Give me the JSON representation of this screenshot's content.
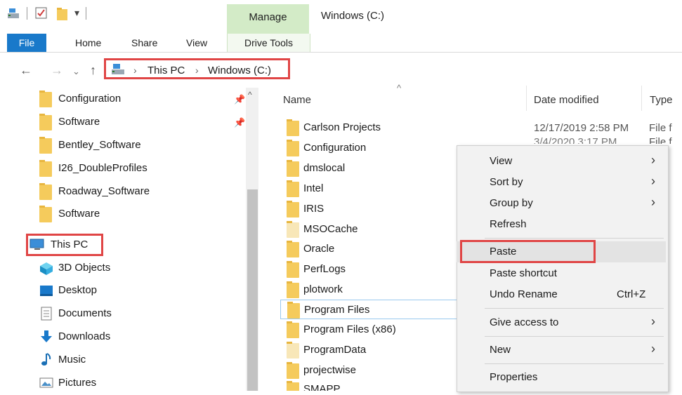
{
  "window": {
    "title": "Windows (C:)",
    "manage_label": "Manage"
  },
  "ribbon": {
    "tabs": [
      {
        "label": "File"
      },
      {
        "label": "Home"
      },
      {
        "label": "Share"
      },
      {
        "label": "View"
      },
      {
        "label": "Drive Tools"
      }
    ]
  },
  "address": {
    "crumbs": [
      "This PC",
      "Windows (C:)"
    ],
    "separator": "›"
  },
  "navpane": {
    "quick_access": [
      {
        "label": "Configuration",
        "icon": "folder-icon",
        "pinned": true
      },
      {
        "label": "Software",
        "icon": "folder-icon",
        "pinned": true
      },
      {
        "label": "Bentley_Software",
        "icon": "folder-icon"
      },
      {
        "label": "I26_DoubleProfiles",
        "icon": "folder-icon"
      },
      {
        "label": "Roadway_Software",
        "icon": "folder-icon"
      },
      {
        "label": "Software",
        "icon": "folder-icon"
      }
    ],
    "this_pc": {
      "label": "This PC",
      "icon": "computer-icon"
    },
    "this_pc_children": [
      {
        "label": "3D Objects",
        "icon": "3d-objects-icon"
      },
      {
        "label": "Desktop",
        "icon": "desktop-icon"
      },
      {
        "label": "Documents",
        "icon": "documents-icon"
      },
      {
        "label": "Downloads",
        "icon": "downloads-icon"
      },
      {
        "label": "Music",
        "icon": "music-icon"
      },
      {
        "label": "Pictures",
        "icon": "pictures-icon"
      }
    ]
  },
  "filelist": {
    "columns": {
      "name": "Name",
      "date": "Date modified",
      "type": "Type"
    },
    "rows": [
      {
        "name": "Carlson Projects",
        "date": "12/17/2019 2:58 PM",
        "type": "File f"
      },
      {
        "name": "Configuration",
        "date": "3/4/2020 3:17 PM",
        "type": "File f"
      },
      {
        "name": "dmslocal"
      },
      {
        "name": "Intel"
      },
      {
        "name": "IRIS"
      },
      {
        "name": "MSOCache"
      },
      {
        "name": "Oracle"
      },
      {
        "name": "PerfLogs"
      },
      {
        "name": "plotwork"
      },
      {
        "name": "Program Files"
      },
      {
        "name": "Program Files (x86)"
      },
      {
        "name": "ProgramData"
      },
      {
        "name": "projectwise"
      },
      {
        "name": "SMAPP"
      }
    ]
  },
  "context_menu": {
    "items": [
      {
        "label": "View",
        "submenu": true
      },
      {
        "label": "Sort by",
        "submenu": true
      },
      {
        "label": "Group by",
        "submenu": true
      },
      {
        "label": "Refresh"
      },
      {
        "label": "Paste"
      },
      {
        "label": "Paste shortcut"
      },
      {
        "label": "Undo Rename",
        "shortcut": "Ctrl+Z"
      },
      {
        "label": "Give access to",
        "submenu": true
      },
      {
        "label": "New",
        "submenu": true
      },
      {
        "label": "Properties"
      }
    ],
    "chevron": "›"
  },
  "colors": {
    "highlight": "#e04545",
    "file_tab": "#1979ca",
    "manage_band": "#d3ebc7",
    "folder": "#f5cb5c"
  }
}
